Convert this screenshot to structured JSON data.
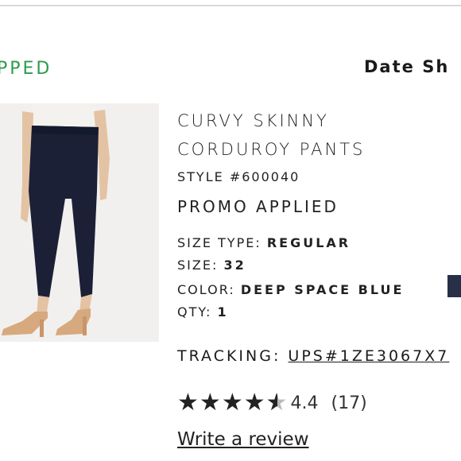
{
  "order": {
    "status": "PPED",
    "date_label": "Date Sh"
  },
  "product": {
    "name_line1": "CURVY SKINNY",
    "name_line2": "CORDUROY PANTS",
    "style": "STYLE #600040",
    "promo": "PROMO APPLIED",
    "size_type_label": "SIZE TYPE:",
    "size_type_value": "REGULAR",
    "size_label": "SIZE:",
    "size_value": "32",
    "color_label": "COLOR:",
    "color_value": "DEEP SPACE BLUE",
    "color_swatch": "#283048",
    "qty_label": "QTY:",
    "qty_value": "1"
  },
  "tracking": {
    "label": "TRACKING:",
    "value": "UPS#1ZE3067X7"
  },
  "rating": {
    "stars": 4.4,
    "value": "4.4",
    "count": "(17)",
    "write_review": "Write a review"
  },
  "colors": {
    "status_green": "#2e9b4a",
    "text": "#1a1a1a"
  }
}
